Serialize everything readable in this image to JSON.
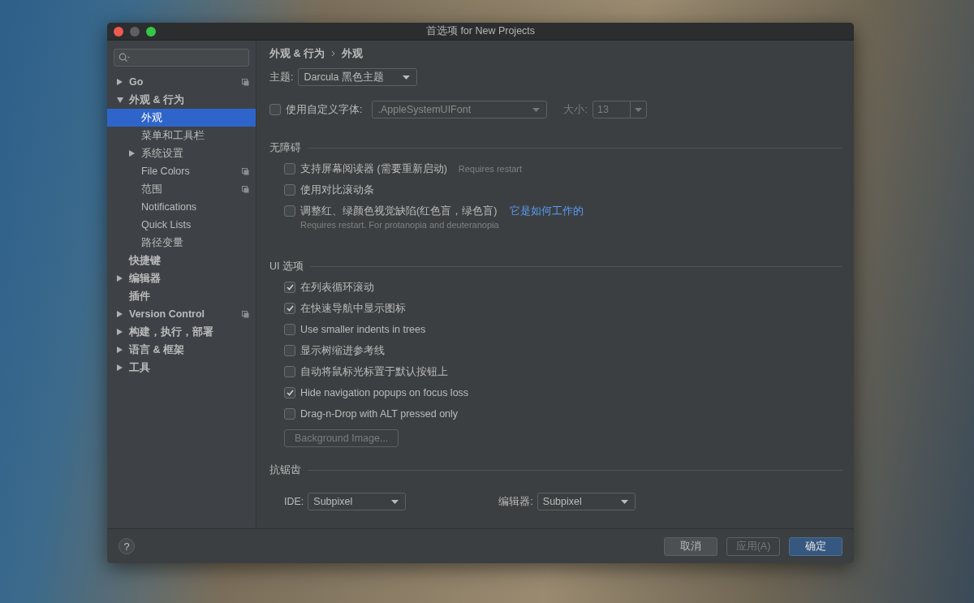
{
  "window": {
    "title": "首选项 for New Projects"
  },
  "sidebar": {
    "items": [
      {
        "label": "Go",
        "expanded": false,
        "selected": false,
        "project_scoped": true
      },
      {
        "label": "外观 & 行为",
        "expanded": true,
        "selected": false,
        "project_scoped": false,
        "children": [
          {
            "label": "外观",
            "selected": true,
            "project_scoped": false
          },
          {
            "label": "菜单和工具栏",
            "selected": false,
            "project_scoped": false
          },
          {
            "label": "系统设置",
            "expanded": false,
            "selected": false,
            "project_scoped": false
          },
          {
            "label": "File Colors",
            "selected": false,
            "project_scoped": true
          },
          {
            "label": "范围",
            "selected": false,
            "project_scoped": true
          },
          {
            "label": "Notifications",
            "selected": false,
            "project_scoped": false
          },
          {
            "label": "Quick Lists",
            "selected": false,
            "project_scoped": false
          },
          {
            "label": "路径变量",
            "selected": false,
            "project_scoped": false
          }
        ]
      },
      {
        "label": "快捷键",
        "selected": false,
        "project_scoped": false
      },
      {
        "label": "编辑器",
        "expanded": false,
        "selected": false,
        "project_scoped": false
      },
      {
        "label": "插件",
        "selected": false,
        "project_scoped": false
      },
      {
        "label": "Version Control",
        "expanded": false,
        "selected": false,
        "project_scoped": true
      },
      {
        "label": "构建，执行，部署",
        "expanded": false,
        "selected": false,
        "project_scoped": false
      },
      {
        "label": "语言 & 框架",
        "expanded": false,
        "selected": false,
        "project_scoped": false
      },
      {
        "label": "工具",
        "expanded": false,
        "selected": false,
        "project_scoped": false
      }
    ]
  },
  "breadcrumb": [
    "外观 & 行为",
    "外观"
  ],
  "theme": {
    "label": "主题:",
    "value": "Darcula 黑色主题"
  },
  "custom_font": {
    "label": "使用自定义字体:",
    "checked": false,
    "font": ".AppleSystemUIFont",
    "size_label": "大小:",
    "size": "13"
  },
  "sections": [
    {
      "title": "无障碍",
      "options": [
        {
          "label": "支持屏幕阅读器 (需要重新启动)",
          "checked": false,
          "hint": "Requires restart"
        },
        {
          "label": "使用对比滚动条",
          "checked": false
        },
        {
          "label": "调整红、绿颜色视觉缺陷(红色盲，绿色盲)",
          "checked": false,
          "link": "它是如何工作的",
          "note": "Requires restart. For protanopia and deuteranopia"
        }
      ]
    },
    {
      "title": "UI 选项",
      "options": [
        {
          "label": "在列表循环滚动",
          "checked": true
        },
        {
          "label": "在快速导航中显示图标",
          "checked": true
        },
        {
          "label": "Use smaller indents in trees",
          "checked": false
        },
        {
          "label": "显示树缩进参考线",
          "checked": false
        },
        {
          "label": "自动将鼠标光标置于默认按钮上",
          "checked": false
        },
        {
          "label": "Hide navigation popups on focus loss",
          "checked": true
        },
        {
          "label": "Drag-n-Drop with ALT pressed only",
          "checked": false
        }
      ],
      "button": {
        "label": "Background Image...",
        "disabled": true
      }
    },
    {
      "title": "抗锯齿",
      "selects": [
        {
          "label": "IDE:",
          "value": "Subpixel"
        },
        {
          "label": "编辑器:",
          "value": "Subpixel"
        }
      ]
    }
  ],
  "footer": {
    "help": "?",
    "buttons": [
      {
        "label": "取消",
        "kind": "normal"
      },
      {
        "label": "应用(A)",
        "kind": "disabled"
      },
      {
        "label": "确定",
        "kind": "default"
      }
    ]
  }
}
